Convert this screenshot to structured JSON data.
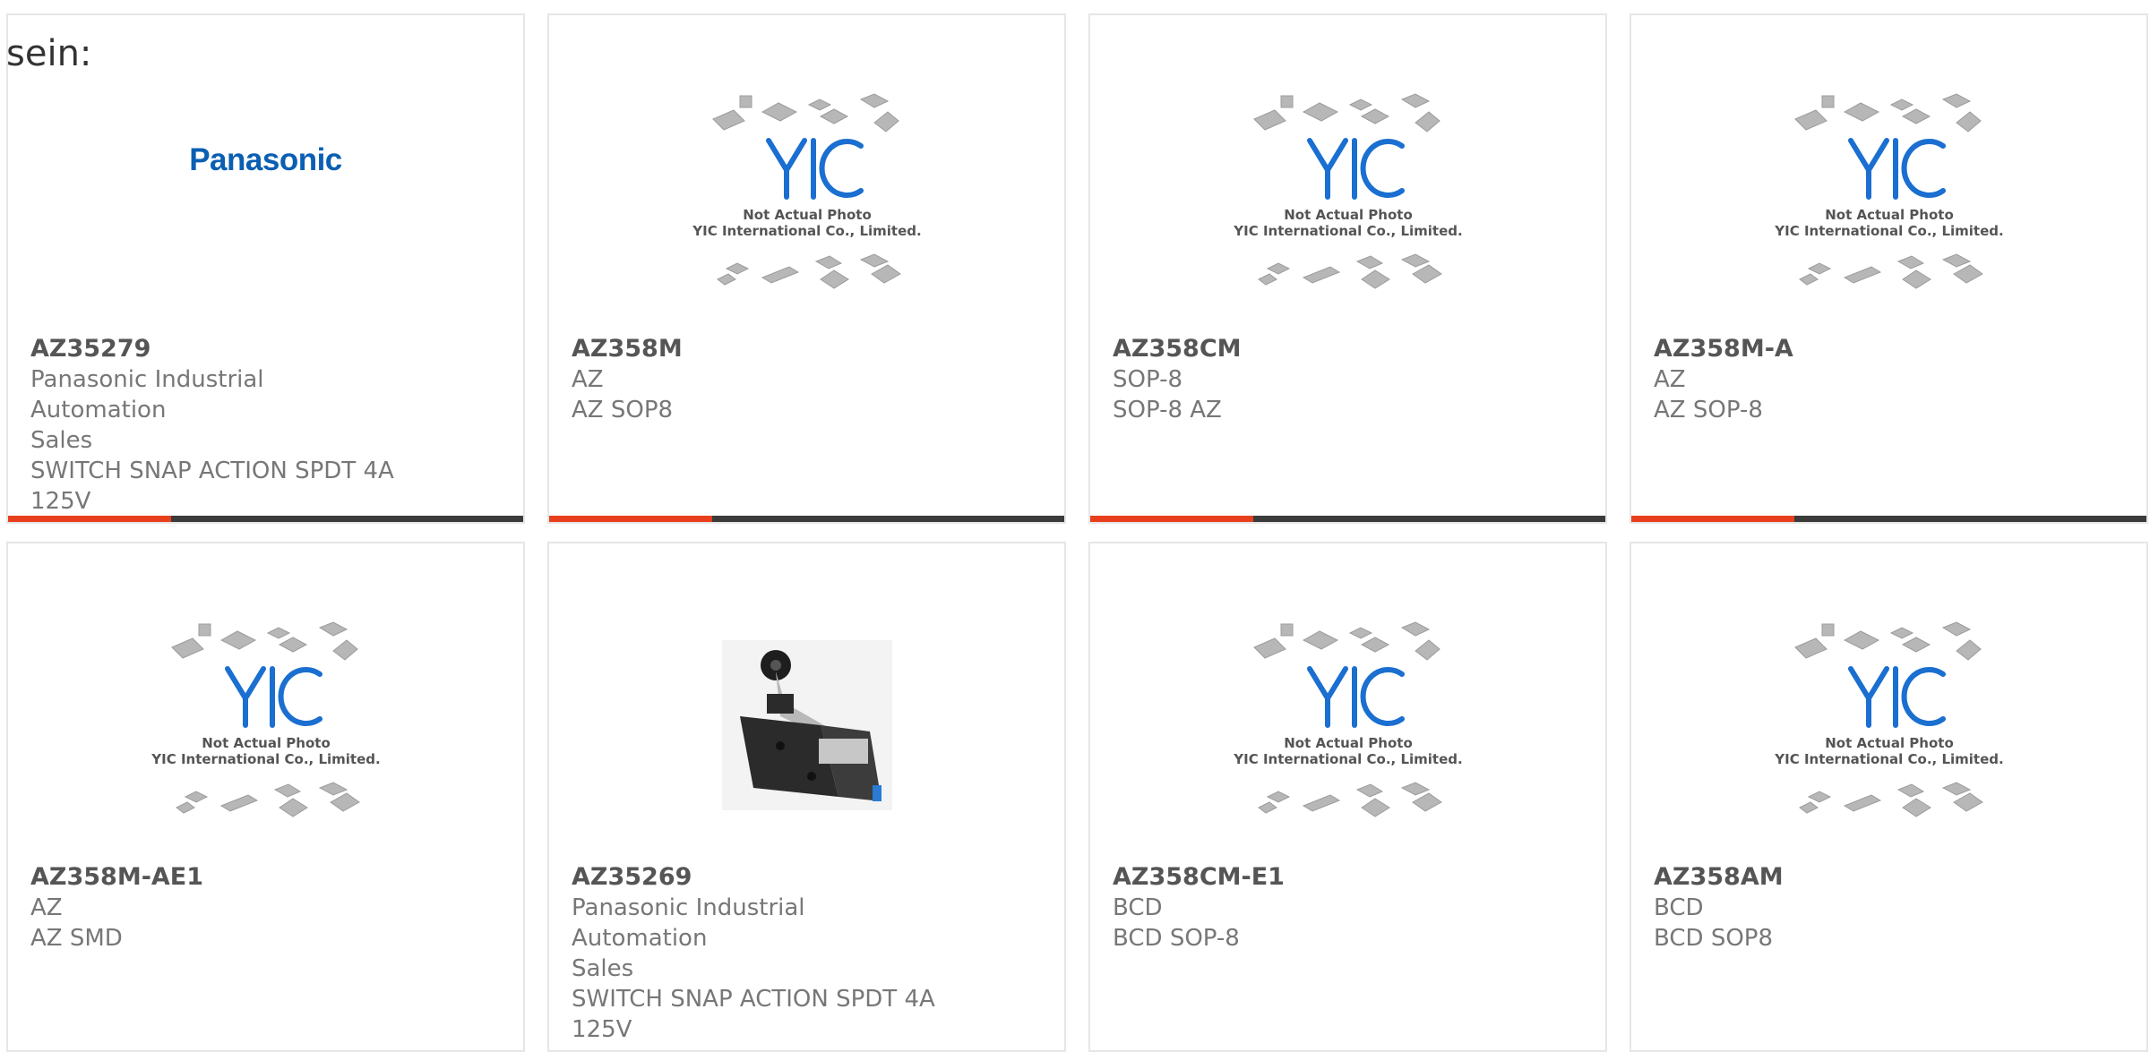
{
  "lead_text": "sein:",
  "colors": {
    "accent": "#e8401c",
    "bar": "#3b3b3b",
    "text": "#777777",
    "part": "#555555",
    "brand": "#0b5fb3",
    "yic": "#1a6fd0"
  },
  "placeholder": {
    "line1": "Not Actual Photo",
    "line2": "YIC International Co., Limited.",
    "logo": "YIC"
  },
  "cards": [
    {
      "image": "panasonic-logo",
      "logo_text": "Panasonic",
      "part": "AZ35279",
      "lines": [
        "Panasonic Industrial Automation",
        "Sales",
        "SWITCH SNAP ACTION SPDT 4A",
        "125V"
      ]
    },
    {
      "image": "yic-placeholder",
      "part": "AZ358M",
      "lines": [
        "AZ",
        "AZ SOP8"
      ]
    },
    {
      "image": "yic-placeholder",
      "part": "AZ358CM",
      "lines": [
        "SOP-8",
        "SOP-8 AZ"
      ]
    },
    {
      "image": "yic-placeholder",
      "part": "AZ358M-A",
      "lines": [
        "AZ",
        "AZ SOP-8"
      ]
    },
    {
      "image": "yic-placeholder",
      "part": "AZ358M-AE1",
      "lines": [
        "AZ",
        "AZ SMD"
      ]
    },
    {
      "image": "switch-photo",
      "part": "AZ35269",
      "lines": [
        "Panasonic Industrial Automation",
        "Sales",
        "SWITCH SNAP ACTION SPDT 4A",
        "125V"
      ]
    },
    {
      "image": "yic-placeholder",
      "part": "AZ358CM-E1",
      "lines": [
        "BCD",
        "BCD SOP-8"
      ]
    },
    {
      "image": "yic-placeholder",
      "part": "AZ358AM",
      "lines": [
        "BCD",
        "BCD SOP8"
      ]
    }
  ]
}
